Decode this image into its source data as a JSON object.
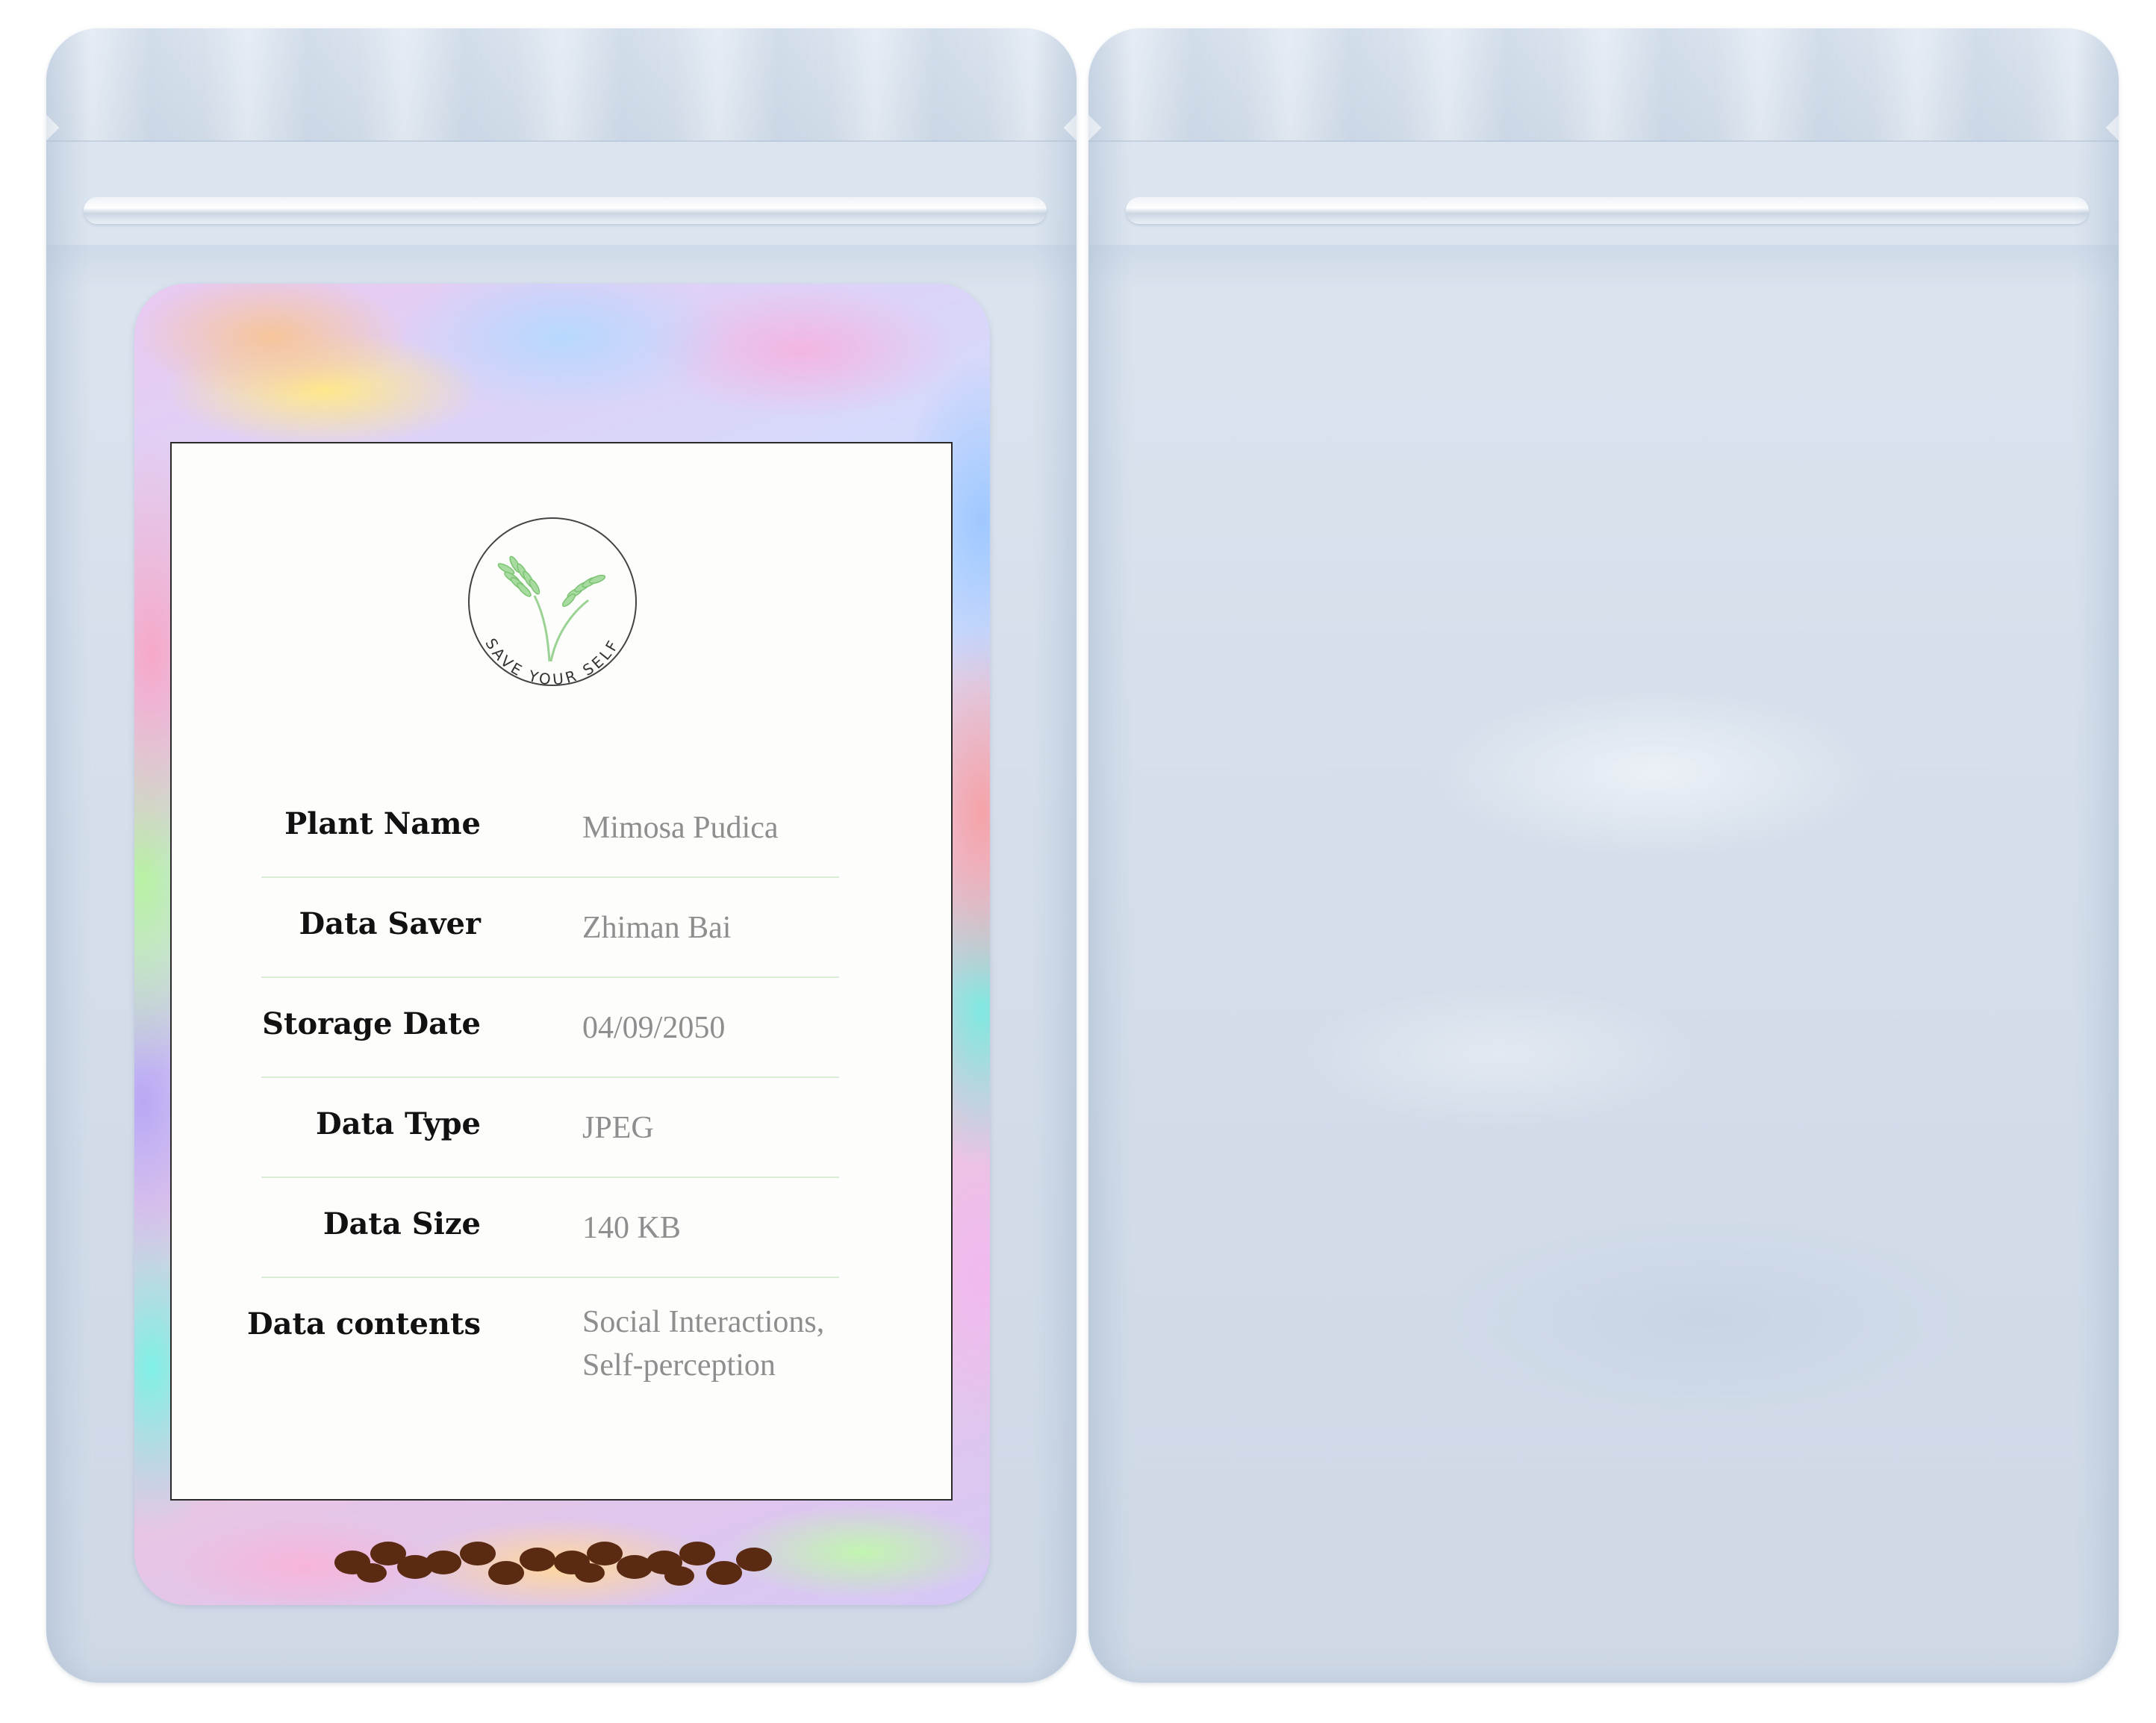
{
  "logo": {
    "text": "SAVE YOUR SELF",
    "icon": "wheat-sprig-icon",
    "accent": "#6fbf6a"
  },
  "label_rows": [
    {
      "key": "Plant Name",
      "value_lines": [
        "Mimosa Pudica"
      ]
    },
    {
      "key": "Data Saver",
      "value_lines": [
        "Zhiman Bai"
      ]
    },
    {
      "key": "Storage Date",
      "value_lines": [
        "04/09/2050"
      ]
    },
    {
      "key": "Data Type",
      "value_lines": [
        "JPEG"
      ]
    },
    {
      "key": "Data Size",
      "value_lines": [
        "140 KB"
      ]
    },
    {
      "key": "Data contents",
      "value_lines": [
        "Social Interactions,",
        "Self-perception"
      ]
    }
  ],
  "colors": {
    "pouch": "#d6e0ec",
    "label": "#fdfdfb",
    "divider": "#d8ecd6",
    "key_text": "#111111",
    "value_text": "#8e8e8e",
    "seed": "#5a2a12"
  },
  "decorations": {
    "seed_count": 17
  }
}
